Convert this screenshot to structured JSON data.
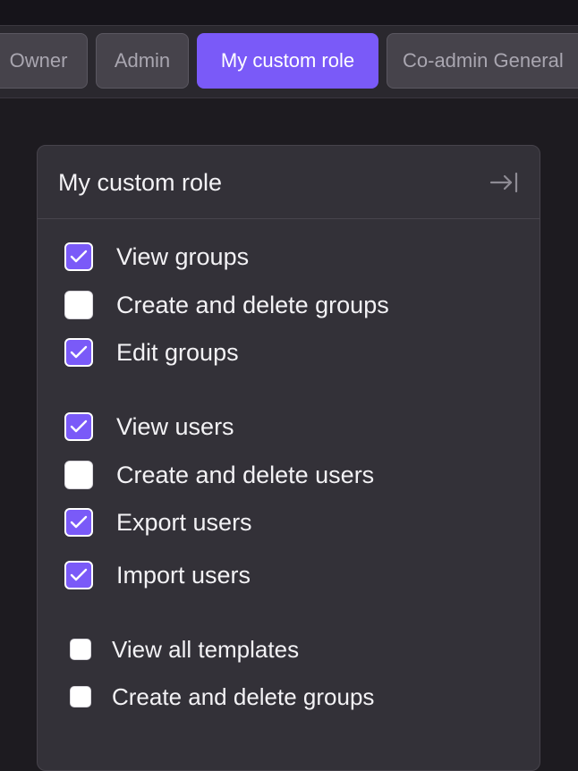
{
  "tabs": [
    {
      "label": "Owner",
      "active": false
    },
    {
      "label": "Admin",
      "active": false
    },
    {
      "label": "My custom role",
      "active": true
    },
    {
      "label": "Co-admin General",
      "active": false
    }
  ],
  "panel": {
    "title": "My custom role",
    "collapse_icon": "collapse-right-icon",
    "permissions": [
      {
        "label": "View groups",
        "checked": true
      },
      {
        "label": "Create and delete groups",
        "checked": false
      },
      {
        "label": "Edit groups",
        "checked": true
      },
      {
        "label": "View users",
        "checked": true
      },
      {
        "label": "Create and delete users",
        "checked": false
      },
      {
        "label": "Export users",
        "checked": true
      },
      {
        "label": "Import users",
        "checked": true
      },
      {
        "label": "View all templates",
        "checked": false
      },
      {
        "label": "Create and delete groups",
        "checked": false
      }
    ]
  },
  "colors": {
    "accent": "#7a5af8",
    "background": "#1d1b20",
    "panel": "#333138",
    "tabbar": "#2a282e"
  }
}
